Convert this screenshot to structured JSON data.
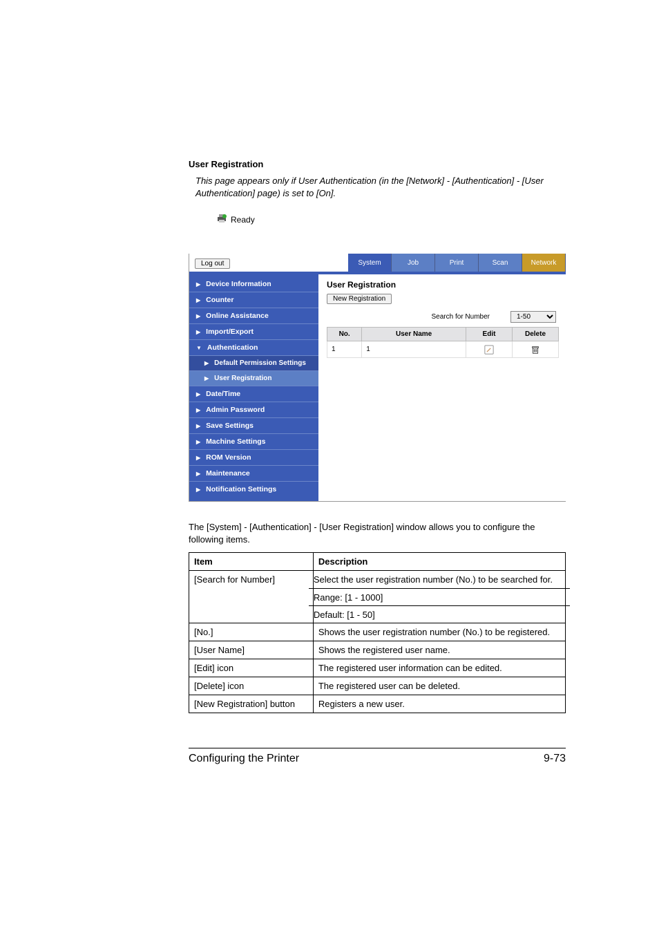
{
  "heading": "User Registration",
  "note": "This page appears only if User Authentication (in the [Network] - [Authentication] - [User Authentication] page) is set to [On].",
  "status": "Ready",
  "logout": "Log out",
  "tabs": {
    "system": "System",
    "job": "Job",
    "print": "Print",
    "scan": "Scan",
    "network": "Network"
  },
  "sidebar": {
    "items": [
      "Device Information",
      "Counter",
      "Online Assistance",
      "Import/Export",
      "Authentication",
      "Date/Time",
      "Admin Password",
      "Save Settings",
      "Machine Settings",
      "ROM Version",
      "Maintenance",
      "Notification Settings"
    ],
    "sub": {
      "dps": "Default Permission Settings",
      "ur": "User Registration"
    }
  },
  "content": {
    "title": "User Registration",
    "new_registration": "New Registration",
    "search_label": "Search for Number",
    "search_value": "1-50",
    "cols": {
      "no": "No.",
      "user": "User Name",
      "edit": "Edit",
      "del": "Delete"
    },
    "row": {
      "no": "1",
      "user": "1"
    }
  },
  "intro": "The [System] - [Authentication] - [User Registration] window allows you to configure the following items.",
  "table": {
    "h_item": "Item",
    "h_desc": "Description",
    "rows": [
      {
        "item": "[Search for Number]",
        "desc_multi": [
          "Select the user registration number (No.) to be searched for.",
          "Range:   [1 - 1000]",
          "Default:  [1 - 50]"
        ]
      },
      {
        "item": "[No.]",
        "desc": "Shows the user registration number (No.) to be registered."
      },
      {
        "item": "[User Name]",
        "desc": "Shows the registered user name."
      },
      {
        "item": "[Edit] icon",
        "desc": "The registered user information can be edited."
      },
      {
        "item": "[Delete] icon",
        "desc": "The registered user can be deleted."
      },
      {
        "item": "[New Registration] button",
        "desc": "Registers a new user."
      }
    ]
  },
  "footer": {
    "left": "Configuring the Printer",
    "right": "9-73"
  }
}
